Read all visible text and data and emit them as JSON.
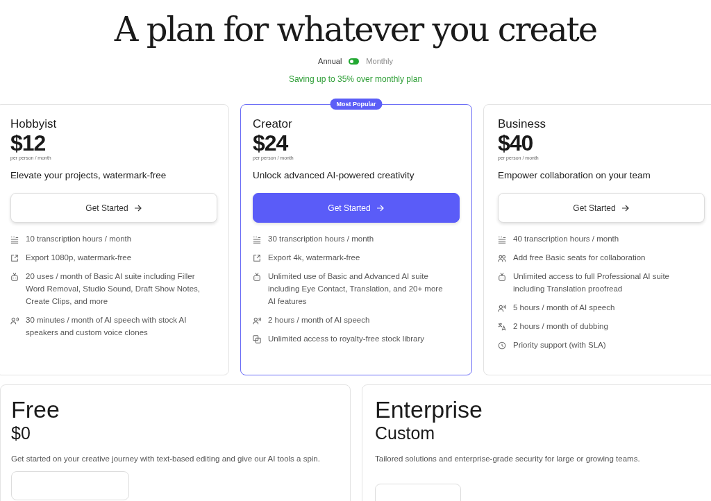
{
  "title": "A plan for whatever you create",
  "billing": [
    {
      "label": "Annual",
      "selected": true
    },
    {
      "label": "Monthly",
      "selected": false
    }
  ],
  "savings": "Saving up to 35% over monthly plan",
  "plans": [
    {
      "name": "Hobbyist",
      "price": "$12",
      "unit": "per person / month",
      "tagline": "Elevate your projects, watermark-free",
      "button": "Get Started",
      "featured": false,
      "features": [
        {
          "kind": "transcript",
          "text": "10 transcription hours / month"
        },
        {
          "kind": "export",
          "text": "Export 1080p, watermark-free"
        },
        {
          "kind": "robot",
          "text": "20 uses / month of Basic AI suite including Filler Word Removal, Studio Sound, Draft Show Notes, Create Clips, and more"
        },
        {
          "kind": "speech",
          "text": "30 minutes / month of AI speech with stock AI speakers and custom voice clones"
        }
      ]
    },
    {
      "name": "Creator",
      "price": "$24",
      "unit": "per person / month",
      "tagline": "Unlock advanced AI-powered creativity",
      "button": "Get Started",
      "featured": true,
      "badge": "Most Popular",
      "features": [
        {
          "kind": "transcript",
          "text": "30 transcription hours / month"
        },
        {
          "kind": "export",
          "text": "Export 4k, watermark-free"
        },
        {
          "kind": "robot",
          "text": "Unlimited use of Basic and Advanced AI suite including Eye Contact, Translation, and 20+ more AI features"
        },
        {
          "kind": "speech",
          "text": "2 hours / month of AI speech"
        },
        {
          "kind": "library",
          "text": "Unlimited access to royalty-free stock library"
        }
      ]
    },
    {
      "name": "Business",
      "price": "$40",
      "unit": "per person / month",
      "tagline": "Empower collaboration on your team",
      "button": "Get Started",
      "featured": false,
      "features": [
        {
          "kind": "transcript",
          "text": "40 transcription hours / month"
        },
        {
          "kind": "seats",
          "text": "Add free Basic seats for collaboration"
        },
        {
          "kind": "robot",
          "text": "Unlimited access to full Professional AI suite including Translation proofread"
        },
        {
          "kind": "speech",
          "text": "5 hours / month of AI speech"
        },
        {
          "kind": "translate",
          "text": "2 hours / month of dubbing"
        },
        {
          "kind": "clock",
          "text": "Priority support (with SLA)"
        }
      ]
    }
  ],
  "other_plans": [
    {
      "name": "Free",
      "price": "$0",
      "description": "Get started on your creative journey with text-based editing and give our AI tools a spin."
    },
    {
      "name": "Enterprise",
      "price": "Custom",
      "description": "Tailored solutions and enterprise-grade security for large or growing teams."
    }
  ]
}
